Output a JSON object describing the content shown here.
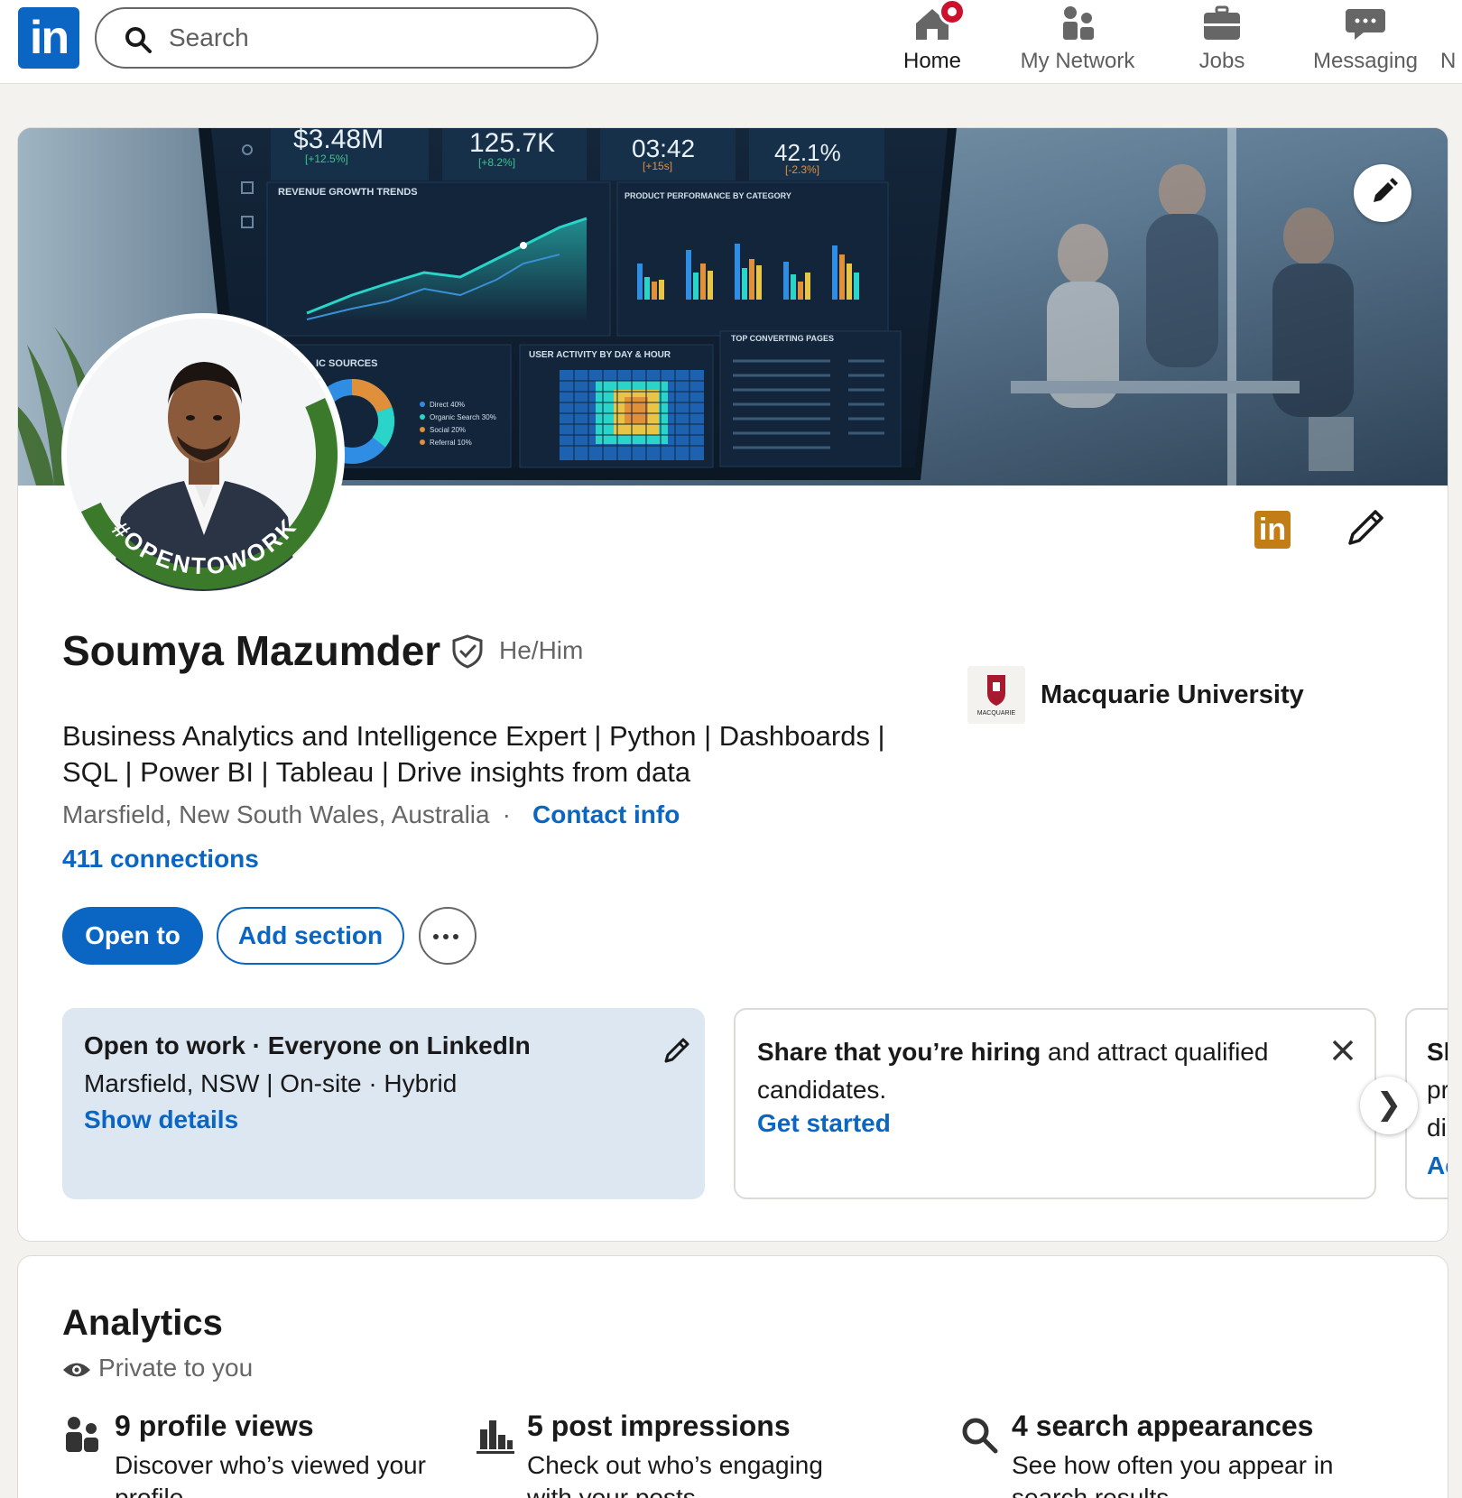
{
  "nav": {
    "search_placeholder": "Search",
    "items": [
      {
        "label": "Home",
        "icon": "home-icon"
      },
      {
        "label": "My Network",
        "icon": "people-icon"
      },
      {
        "label": "Jobs",
        "icon": "briefcase-icon"
      },
      {
        "label": "Messaging",
        "icon": "chat-icon"
      },
      {
        "label": "N",
        "icon": "bell-icon"
      }
    ],
    "logo_text": "in"
  },
  "banner": {
    "dashboard_kpis": [
      "$3.48M",
      "125.7K",
      "03:42",
      "42.1%"
    ],
    "dashboard_deltas": [
      "[+12.5%]",
      "[+8.2%]",
      "[+15s]",
      "[-2.3%]"
    ],
    "panel_titles": [
      "REVENUE GROWTH TRENDS",
      "PRODUCT PERFORMANCE BY CATEGORY",
      "USER ACTIVITY BY DAY & HOUR",
      "TOP CONVERTING PAGES",
      "IC SOURCES"
    ],
    "legend": [
      "Direct 40%",
      "Organic Search 30%",
      "Social 20%",
      "Referral 10%"
    ]
  },
  "profile": {
    "name": "Soumya Mazumder",
    "pronouns": "He/Him",
    "headline": "Business Analytics and Intelligence Expert | Python | Dashboards | SQL | Power BI | Tableau | Drive insights from data",
    "location": "Marsfield, New South Wales, Australia",
    "contact_label": "Contact info",
    "connections": "411 connections",
    "badge_logo_text": "in",
    "open_to_work_ring": "#OPENTOWORK"
  },
  "education": {
    "name": "Macquarie University",
    "logo_text": "MACQUARIE"
  },
  "actions": {
    "open_to": "Open to",
    "add_section": "Add section"
  },
  "open_to_work": {
    "title": "Open to work · Everyone on LinkedIn",
    "subtitle": "Marsfield, NSW | On-site · Hybrid",
    "link": "Show details"
  },
  "hiring": {
    "bold": "Share that you’re hiring",
    "rest": " and attract qualified candidates.",
    "link": "Get started"
  },
  "peek": {
    "lines": [
      "Sl",
      "pr",
      "di",
      "Ac"
    ]
  },
  "analytics": {
    "title": "Analytics",
    "privacy": "Private to you",
    "metrics": [
      {
        "title": "9 profile views",
        "desc": "Discover who’s viewed your profile.",
        "icon": "people-icon"
      },
      {
        "title": "5 post impressions",
        "desc": "Check out who’s engaging with your posts.",
        "icon": "bar-chart-icon"
      },
      {
        "title": "4 search appearances",
        "desc": "See how often you appear in search results.",
        "icon": "search-icon"
      }
    ]
  },
  "colors": {
    "brand": "#0a66c2",
    "otw_green": "#3b7a2a",
    "badge_gold": "#c37d16",
    "notification": "#cb112d"
  }
}
